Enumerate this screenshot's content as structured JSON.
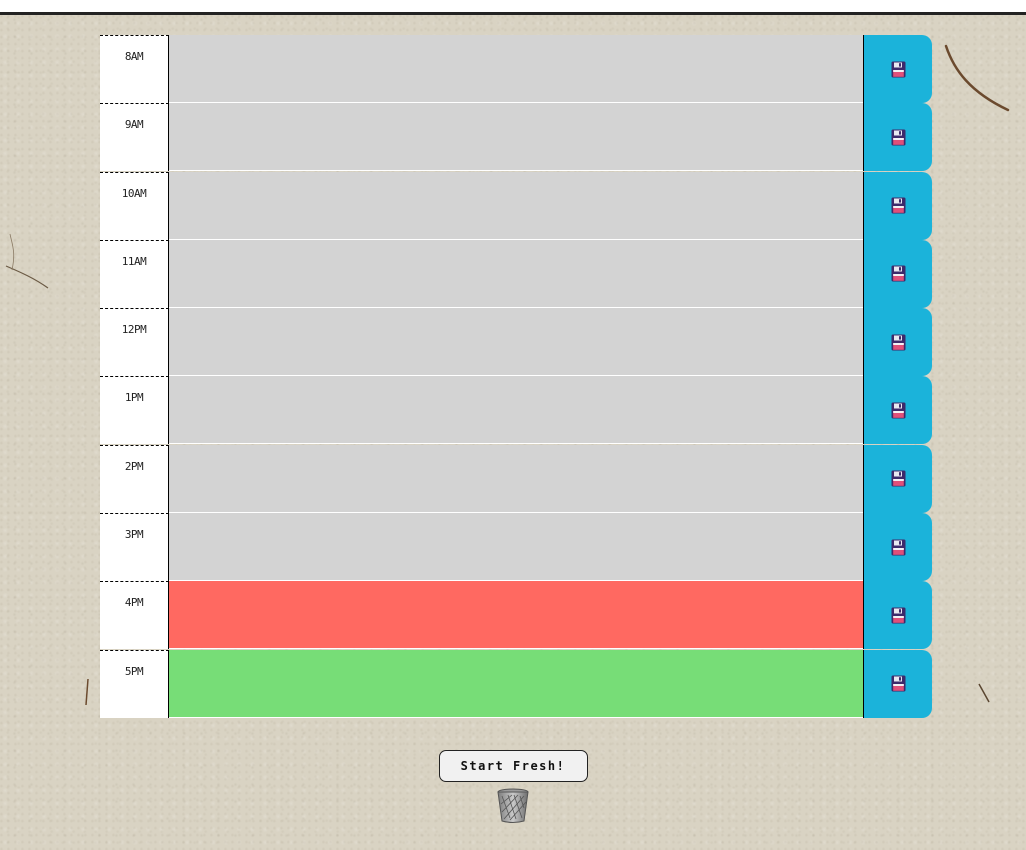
{
  "colors": {
    "past": "#d3d3d3",
    "present": "#ff6961",
    "future": "#77dd77",
    "save": "#1bb3da"
  },
  "time_blocks": [
    {
      "hour": "8AM",
      "text": "",
      "status": "past"
    },
    {
      "hour": "9AM",
      "text": "",
      "status": "past"
    },
    {
      "hour": "10AM",
      "text": "",
      "status": "past"
    },
    {
      "hour": "11AM",
      "text": "",
      "status": "past"
    },
    {
      "hour": "12PM",
      "text": "",
      "status": "past"
    },
    {
      "hour": "1PM",
      "text": "",
      "status": "past"
    },
    {
      "hour": "2PM",
      "text": "",
      "status": "past"
    },
    {
      "hour": "3PM",
      "text": "",
      "status": "past"
    },
    {
      "hour": "4PM",
      "text": "",
      "status": "present"
    },
    {
      "hour": "5PM",
      "text": "",
      "status": "future"
    }
  ],
  "save_icon": "floppy-disk-icon",
  "footer": {
    "clear_label": "Start Fresh!",
    "trash_icon": "trash-bin-icon"
  }
}
